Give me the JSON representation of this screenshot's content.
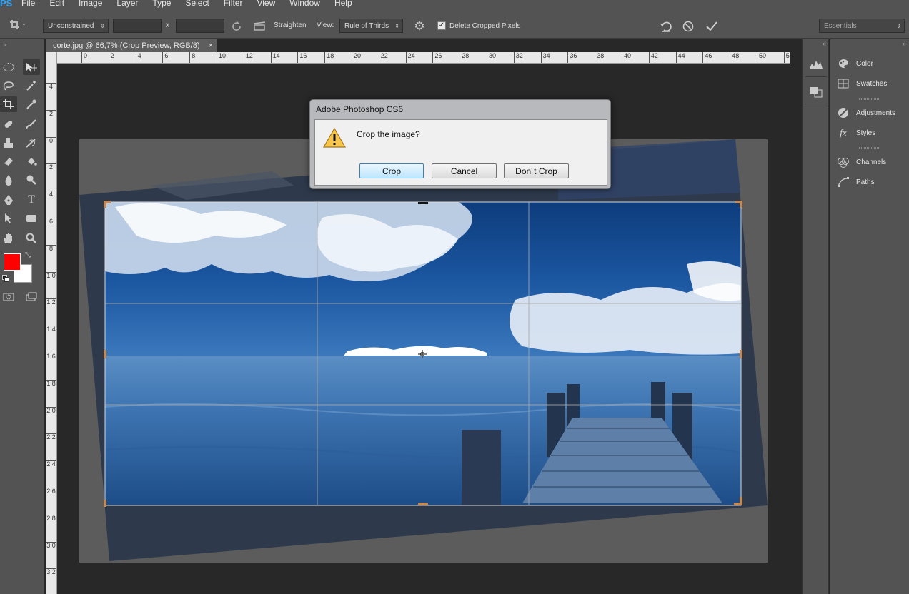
{
  "app": {
    "logo": "PS"
  },
  "menu": [
    "File",
    "Edit",
    "Image",
    "Layer",
    "Type",
    "Select",
    "Filter",
    "View",
    "Window",
    "Help"
  ],
  "options": {
    "ratio": "Unconstrained",
    "times": "x",
    "straighten_label": "Straighten",
    "view_label": "View:",
    "view_value": "Rule of Thirds",
    "delete_label": "Delete Cropped Pixels",
    "delete_checked": true,
    "workspace": "Essentials"
  },
  "document": {
    "tab_title": "corte.jpg @ 66,7% (Crop Preview, RGB/8)",
    "tab_close": "×",
    "h_ruler": [
      "0",
      "2",
      "4",
      "6",
      "8",
      "10",
      "12",
      "14",
      "16",
      "18",
      "20",
      "22",
      "24",
      "26",
      "28",
      "30",
      "32",
      "34",
      "36",
      "38",
      "40",
      "42",
      "44",
      "46",
      "48",
      "50",
      "5"
    ],
    "v_ruler": [
      "4",
      "2",
      "0",
      "2",
      "4",
      "6",
      "8",
      "1 0",
      "1 2",
      "1 4",
      "1 6",
      "1 8",
      "2 0",
      "2 2",
      "2 4",
      "2 6",
      "2 8",
      "3 0",
      "3 2"
    ]
  },
  "dialog": {
    "title": "Adobe Photoshop CS6",
    "message": "Crop the image?",
    "buttons": {
      "crop": "Crop",
      "cancel": "Cancel",
      "dont_crop": "Don´t Crop"
    }
  },
  "panels": {
    "color": "Color",
    "swatches": "Swatches",
    "adjustments": "Adjustments",
    "styles": "Styles",
    "channels": "Channels",
    "paths": "Paths"
  },
  "colors": {
    "foreground": "#ff0000",
    "background": "#ffffff",
    "accent": "#31a8ff"
  }
}
